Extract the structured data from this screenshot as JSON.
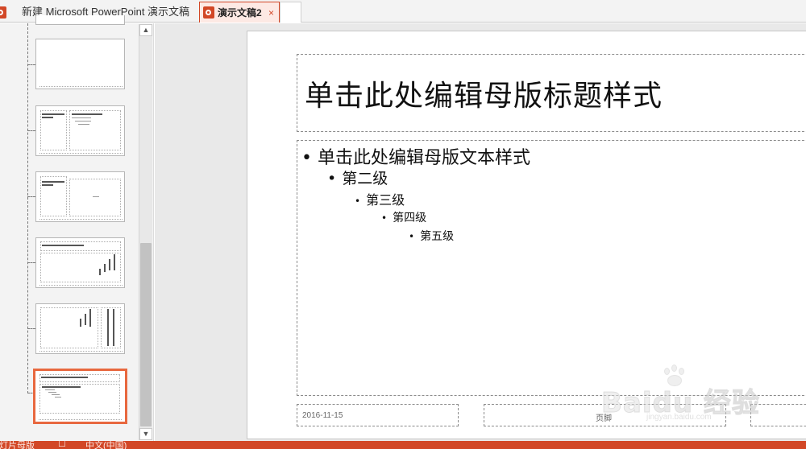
{
  "tabs": [
    {
      "label": "新建 Microsoft PowerPoint 演示文稿",
      "icon": "powerpoint-icon",
      "active": false
    },
    {
      "label": "演示文稿2",
      "icon": "powerpoint-icon",
      "active": true,
      "close_glyph": "×"
    }
  ],
  "scrollbar": {
    "up_glyph": "▲",
    "down_glyph": "▼"
  },
  "thumbnails": [
    {
      "label": "empty layout"
    },
    {
      "label": "comparison layout"
    },
    {
      "label": "content with caption layout"
    },
    {
      "label": "title and vertical text layout"
    },
    {
      "label": "vertical title and text layout"
    },
    {
      "label": "slide master",
      "selected": true
    }
  ],
  "slide": {
    "title": "单击此处编辑母版标题样式",
    "bullets": [
      {
        "level": 1,
        "text": "单击此处编辑母版文本样式"
      },
      {
        "level": 2,
        "text": "第二级"
      },
      {
        "level": 3,
        "text": "第三级"
      },
      {
        "level": 4,
        "text": "第四级"
      },
      {
        "level": 5,
        "text": "第五级"
      }
    ],
    "bullet_glyph": "•",
    "date": "2016-11-15",
    "footer": "页脚"
  },
  "statusbar": {
    "view_label": "幻灯片母版",
    "language": "中文(中国)"
  },
  "colors": {
    "accent": "#d24726",
    "selected_thumb_border": "#e8683f"
  }
}
